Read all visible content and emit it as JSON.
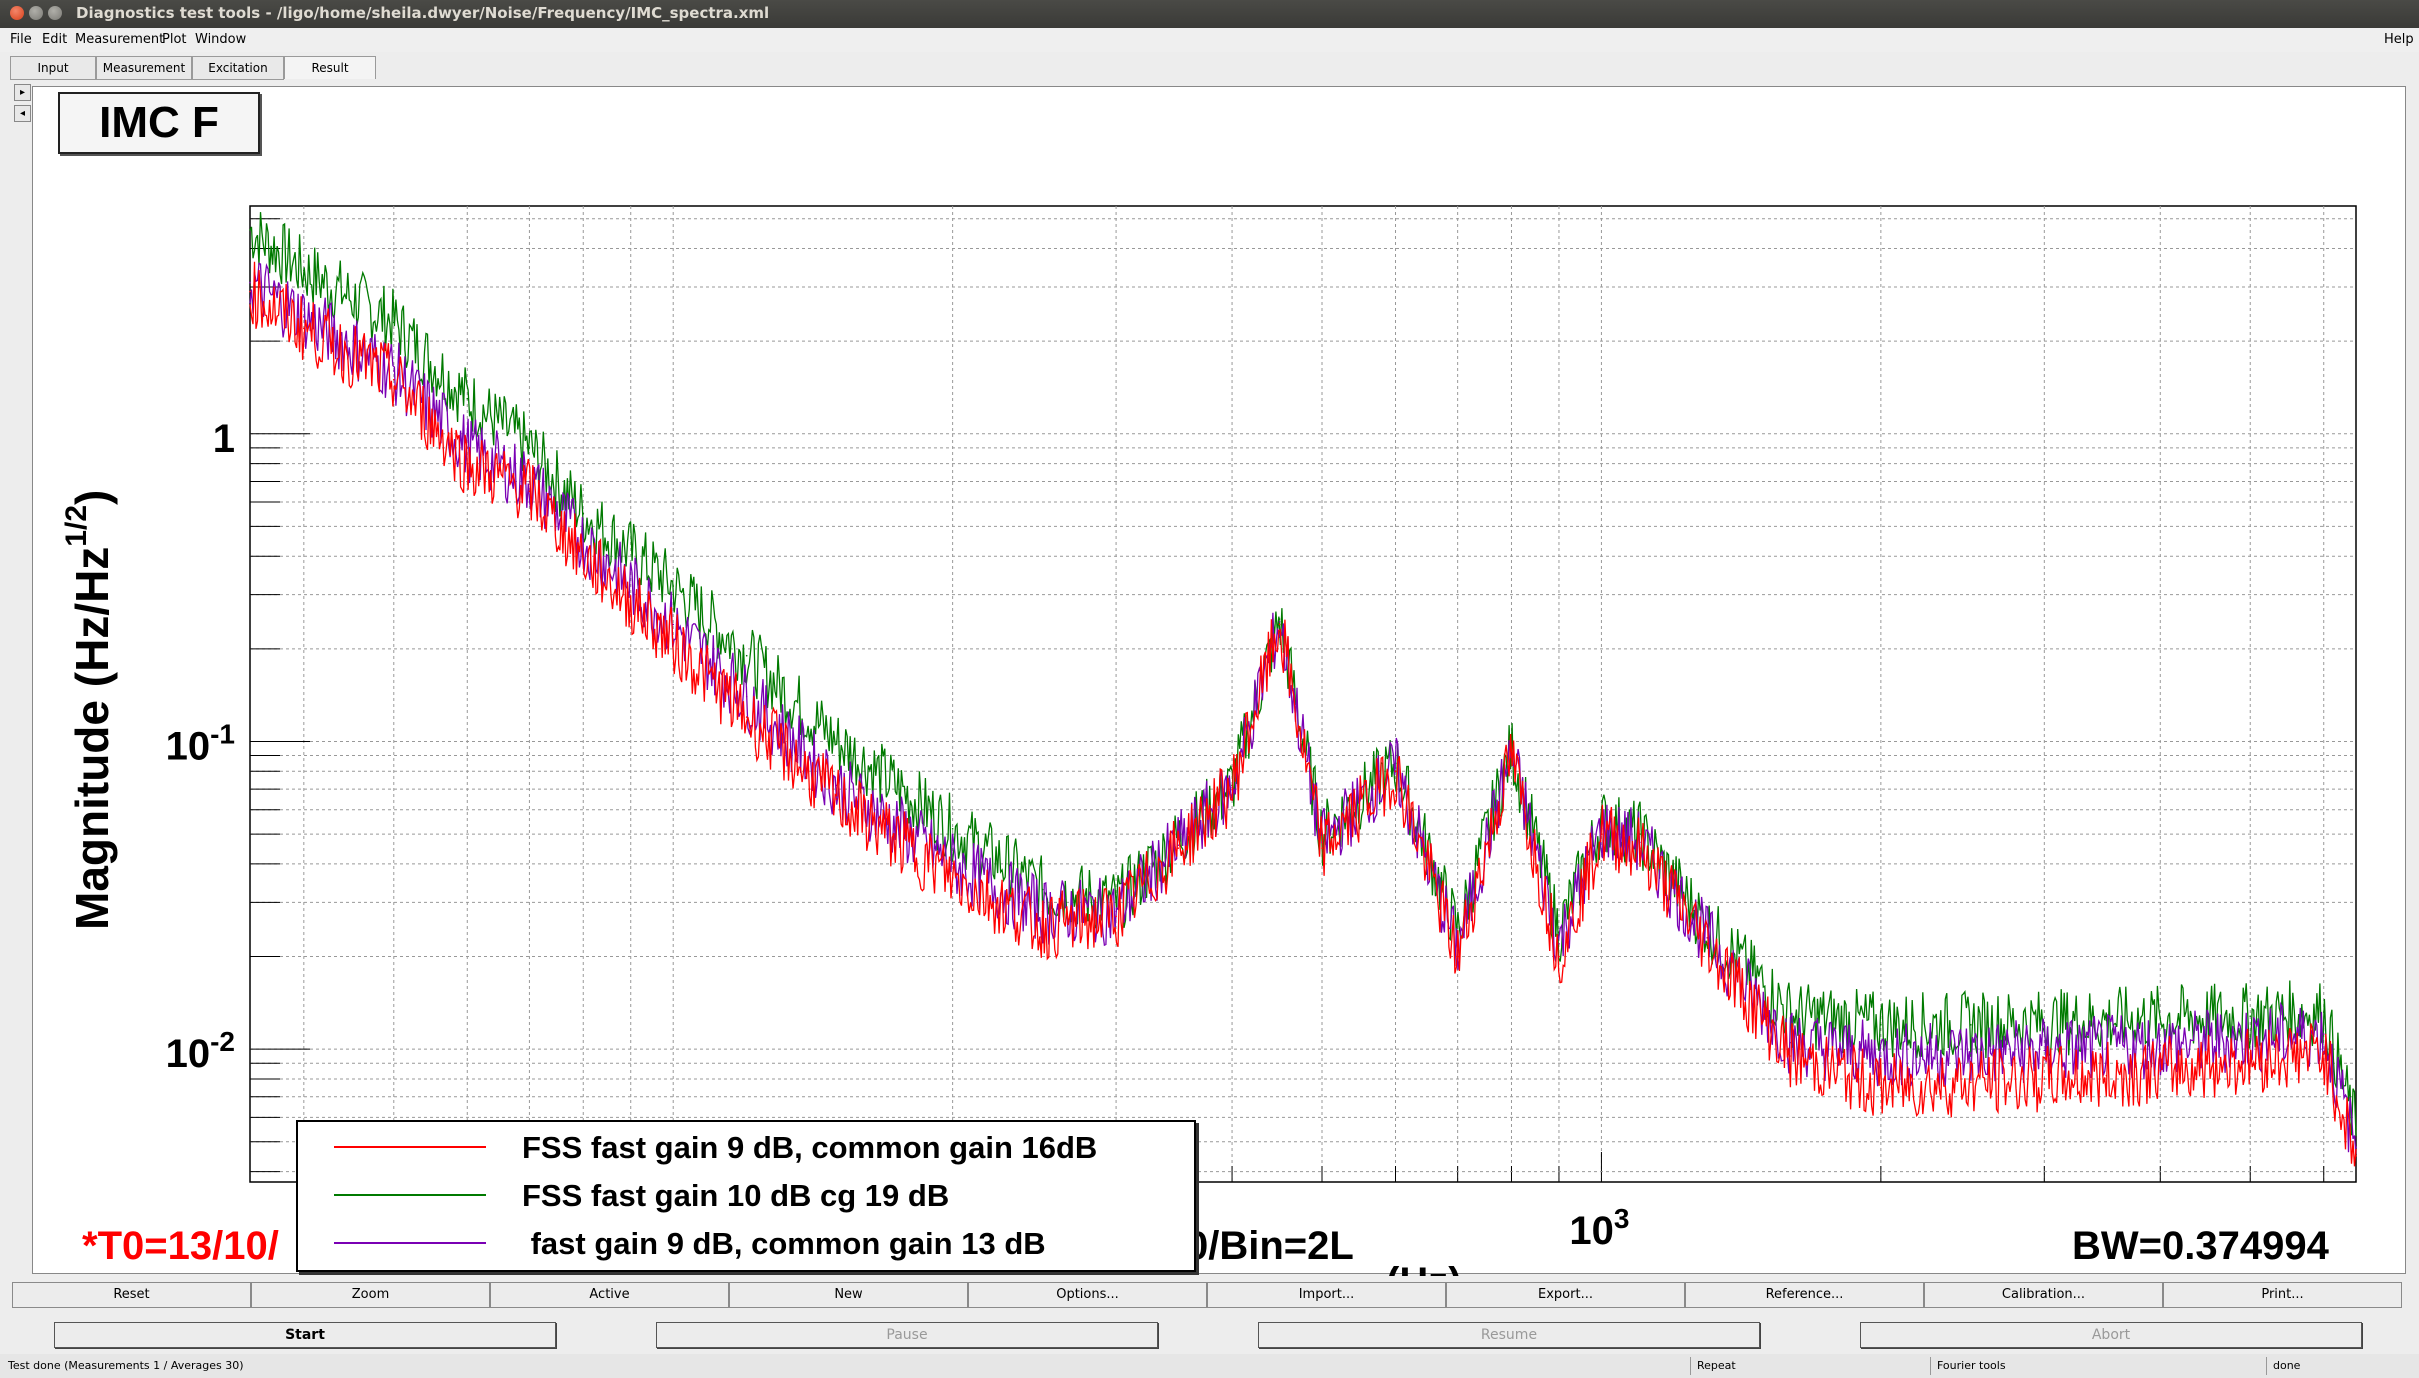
{
  "window": {
    "title": "Diagnostics test tools - /ligo/home/sheila.dwyer/Noise/Frequency/IMC_spectra.xml"
  },
  "menu": {
    "file": "File",
    "edit": "Edit",
    "measurement": "Measurement",
    "plot": "Plot",
    "window": "Window",
    "help": "Help"
  },
  "tabs": [
    "Input",
    "Measurement",
    "Excitation",
    "Result"
  ],
  "plot": {
    "title": "IMC F",
    "ylabel_main": "Magnitude (Hz/Hz",
    "ylabel_sup": "1/2",
    "ylabel_close": ")",
    "y_ticks": [
      {
        "base": "10",
        "exp": "-2"
      },
      {
        "base": "10",
        "exp": "-1"
      },
      {
        "base": "1",
        "exp": ""
      }
    ],
    "x_tick": {
      "base": "10",
      "exp": "3"
    },
    "t0": "*T0=13/10/",
    "avg_bin": "0/Bin=2L",
    "xlabel_fragment": "(Hz)",
    "bw": "BW=0.374994"
  },
  "legend": [
    {
      "label": "FSS fast gain 9 dB, common gain 16dB",
      "color": "#ff0000"
    },
    {
      "label": "FSS fast gain 10 dB cg 19 dB",
      "color": "#007a00"
    },
    {
      "label": " fast gain 9 dB, common gain 13 dB",
      "color": "#7a00b4"
    }
  ],
  "chart_data": {
    "type": "line",
    "title": "IMC F",
    "xlabel": "",
    "ylabel": "Magnitude (Hz/Hz^1/2)",
    "x_scale": "log",
    "y_scale": "log",
    "xlim": [
      35,
      6500
    ],
    "ylim": [
      0.0037,
      5.5
    ],
    "grid": true,
    "legend_position": "bottom-left",
    "x": [
      35,
      40,
      50,
      60,
      70,
      80,
      100,
      120,
      150,
      200,
      250,
      300,
      350,
      400,
      450,
      500,
      600,
      700,
      800,
      900,
      1000,
      1100,
      1300,
      1600,
      2000,
      2500,
      3000,
      3500,
      4000,
      5000,
      6000,
      6500
    ],
    "series": [
      {
        "name": "FSS fast gain 9 dB, common gain 16dB",
        "color": "#ff0000",
        "values": [
          2.9,
          2.2,
          1.5,
          0.8,
          0.65,
          0.4,
          0.21,
          0.12,
          0.065,
          0.036,
          0.025,
          0.027,
          0.045,
          0.07,
          0.24,
          0.045,
          0.08,
          0.02,
          0.09,
          0.02,
          0.05,
          0.045,
          0.022,
          0.0095,
          0.0075,
          0.0078,
          0.008,
          0.0082,
          0.0085,
          0.0092,
          0.0098,
          0.0045
        ]
      },
      {
        "name": "FSS fast gain 10 dB cg 19 dB",
        "color": "#007a00",
        "values": [
          4.6,
          3.4,
          2.3,
          1.3,
          0.9,
          0.55,
          0.32,
          0.19,
          0.1,
          0.052,
          0.033,
          0.03,
          0.048,
          0.072,
          0.25,
          0.05,
          0.085,
          0.024,
          0.095,
          0.024,
          0.055,
          0.05,
          0.025,
          0.013,
          0.012,
          0.012,
          0.0122,
          0.0124,
          0.0126,
          0.0128,
          0.0132,
          0.0055
        ]
      },
      {
        "name": " fast gain 9 dB, common gain 13 dB",
        "color": "#7a00b4",
        "values": [
          3.1,
          2.4,
          1.6,
          0.9,
          0.7,
          0.45,
          0.24,
          0.14,
          0.072,
          0.04,
          0.028,
          0.028,
          0.046,
          0.071,
          0.245,
          0.047,
          0.082,
          0.021,
          0.092,
          0.022,
          0.052,
          0.047,
          0.023,
          0.0105,
          0.0095,
          0.0097,
          0.0099,
          0.0101,
          0.0103,
          0.0108,
          0.0112,
          0.0048
        ]
      }
    ]
  },
  "buttons_row1": [
    "Reset",
    "Zoom",
    "Active",
    "New",
    "Options...",
    "Import...",
    "Export...",
    "Reference...",
    "Calibration...",
    "Print..."
  ],
  "buttons_row2": [
    "Start",
    "Pause",
    "Resume",
    "Abort"
  ],
  "status": {
    "left": "Test done (Measurements 1 / Averages 30)",
    "repeat": "Repeat",
    "fourier": "Fourier tools",
    "done": "done"
  }
}
